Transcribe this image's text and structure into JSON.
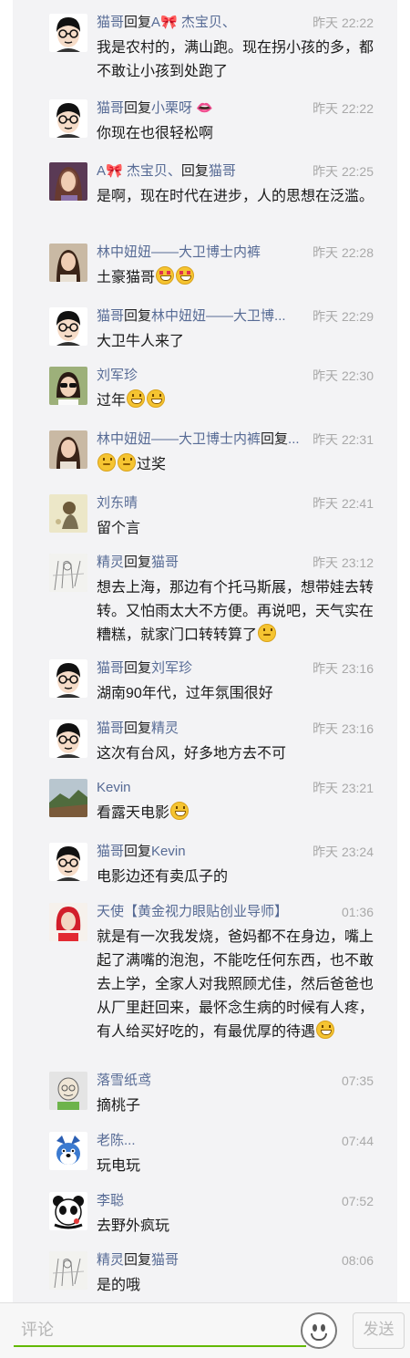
{
  "reply_word": "回复",
  "comments": [
    {
      "author": "猫哥",
      "reply_to": "A🎀 杰宝贝、",
      "time": "昨天 22:22",
      "text": "我是农村的，满山跑。现在拐小孩的多，都不敢让小孩到处跑了",
      "emojis": [],
      "avatar": "cartoon-glasses-man"
    },
    {
      "author": "猫哥",
      "reply_to": "小栗呀 👄",
      "time": "昨天 22:22",
      "text": "你现在也很轻松啊",
      "emojis": [],
      "avatar": "cartoon-glasses-man"
    },
    {
      "author": "A🎀 杰宝贝、",
      "reply_to": "猫哥",
      "time": "昨天 22:25",
      "text": "是啊，现在时代在进步，人的思想在泛滥。",
      "emojis": [],
      "avatar": "woman-photo"
    },
    {
      "author": "林中妞妞——大卫博士内裤",
      "reply_to": "",
      "time": "昨天 22:28",
      "text": "土豪猫哥",
      "emojis": [
        "heart-eyes",
        "heart-eyes"
      ],
      "avatar": "woman-photo-2"
    },
    {
      "author": "猫哥",
      "reply_to": "林中妞妞——大卫博...",
      "time": "昨天 22:29",
      "text": "大卫牛人来了",
      "emojis": [],
      "avatar": "cartoon-glasses-man"
    },
    {
      "author": "刘军珍",
      "reply_to": "",
      "time": "昨天 22:30",
      "text": "过年",
      "emojis": [
        "grin",
        "grin"
      ],
      "avatar": "woman-sunglasses"
    },
    {
      "author": "林中妞妞——大卫博士内裤",
      "reply_to": "...",
      "time": "昨天 22:31",
      "text": "过奖",
      "emojis_before": [
        "think",
        "think"
      ],
      "emojis": [],
      "avatar": "woman-photo-2"
    },
    {
      "author": "刘东晴",
      "reply_to": "",
      "time": "昨天 22:41",
      "text": "留个言",
      "emojis": [],
      "avatar": "illustration-figure"
    },
    {
      "author": "精灵",
      "reply_to": "猫哥",
      "time": "昨天 23:12",
      "text": "想去上海，那边有个托马斯展，想带娃去转转。又怕雨太大不方便。再说吧，天气实在糟糕，就家门口转转算了",
      "emojis": [
        "think"
      ],
      "avatar": "sketch-art"
    },
    {
      "author": "猫哥",
      "reply_to": "刘军珍",
      "time": "昨天 23:16",
      "text": "湖南90年代，过年氛围很好",
      "emojis": [],
      "avatar": "cartoon-glasses-man"
    },
    {
      "author": "猫哥",
      "reply_to": "精灵",
      "time": "昨天 23:16",
      "text": "这次有台风，好多地方去不可",
      "emojis": [],
      "avatar": "cartoon-glasses-man"
    },
    {
      "author": "Kevin",
      "reply_to": "",
      "time": "昨天 23:21",
      "text": "看露天电影",
      "emojis": [
        "grin"
      ],
      "avatar": "landscape-photo"
    },
    {
      "author": "猫哥",
      "reply_to": "Kevin",
      "time": "昨天 23:24",
      "text": "电影边还有卖瓜子的",
      "emojis": [],
      "avatar": "cartoon-glasses-man"
    },
    {
      "author": "天使【黄金视力眼贴创业导师】",
      "reply_to": "",
      "time": "01:36",
      "text": "就是有一次我发烧，爸妈都不在身边，嘴上起了满嘴的泡泡，不能吃任何东西，也不敢去上学，全家人对我照顾尤佳，然后爸爸也从厂里赶回来，最怀念生病的时候有人疼，有人给买好吃的，有最优厚的待遇",
      "emojis": [
        "grin"
      ],
      "avatar": "woman-red-photo"
    },
    {
      "author": "落雪纸鸢",
      "reply_to": "",
      "time": "07:35",
      "text": "摘桃子",
      "emojis": [],
      "avatar": "cartoon-bald-man"
    },
    {
      "author": "老陈...",
      "reply_to": "",
      "time": "07:44",
      "text": "玩电玩",
      "emojis": [],
      "avatar": "blue-dog-cartoon"
    },
    {
      "author": "李聪",
      "reply_to": "",
      "time": "07:52",
      "text": "去野外疯玩",
      "emojis": [],
      "avatar": "panda-logo"
    },
    {
      "author": "精灵",
      "reply_to": "猫哥",
      "time": "08:06",
      "text": "是的哦",
      "emojis": [],
      "avatar": "sketch-art"
    }
  ],
  "input": {
    "placeholder": "评论",
    "send_label": "发送"
  },
  "colors": {
    "name": "#576b95",
    "feed_bg": "#f3f3f5",
    "input_underline": "#62b900"
  }
}
